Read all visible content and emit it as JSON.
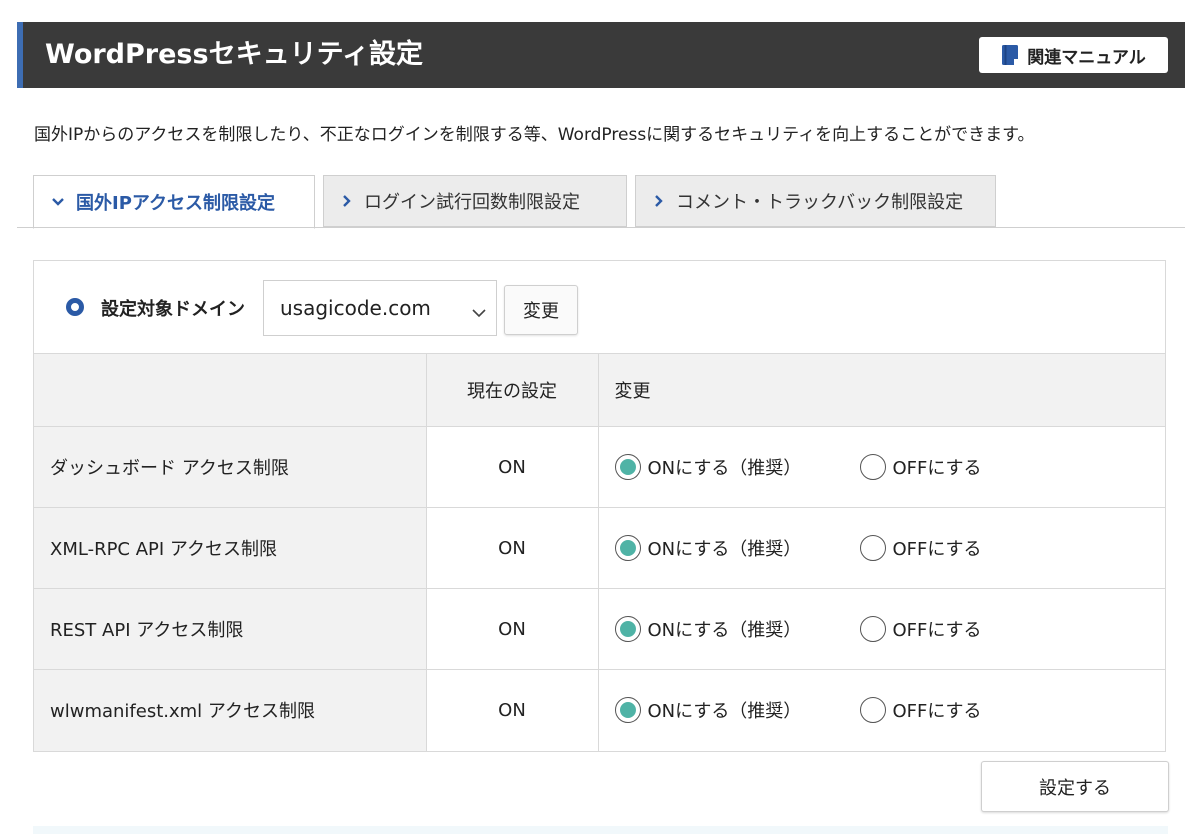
{
  "header": {
    "title": "WordPressセキュリティ設定",
    "manual_label": "関連マニュアル"
  },
  "description": "国外IPからのアクセスを制限したり、不正なログインを制限する等、WordPressに関するセキュリティを向上することができます。",
  "tabs": [
    {
      "label": "国外IPアクセス制限設定",
      "active": true
    },
    {
      "label": "ログイン試行回数制限設定",
      "active": false
    },
    {
      "label": "コメント・トラックバック制限設定",
      "active": false
    }
  ],
  "domain": {
    "label": "設定対象ドメイン",
    "selected": "usagicode.com",
    "change_label": "変更"
  },
  "table": {
    "headers": [
      "",
      "現在の設定",
      "変更"
    ],
    "rows": [
      {
        "name": "ダッシュボード アクセス制限",
        "current": "ON",
        "on_label": "ONにする（推奨）",
        "off_label": "OFFにする",
        "selected": "on"
      },
      {
        "name": "XML-RPC API アクセス制限",
        "current": "ON",
        "on_label": "ONにする（推奨）",
        "off_label": "OFFにする",
        "selected": "on"
      },
      {
        "name": "REST API アクセス制限",
        "current": "ON",
        "on_label": "ONにする（推奨）",
        "off_label": "OFFにする",
        "selected": "on"
      },
      {
        "name": "wlwmanifest.xml アクセス制限",
        "current": "ON",
        "on_label": "ONにする（推奨）",
        "off_label": "OFFにする",
        "selected": "on"
      }
    ]
  },
  "submit_label": "設定する",
  "colors": {
    "header_bg": "#3a3a3a",
    "accent_blue": "#2b5aa6",
    "radio_selected": "#4fb3a6"
  }
}
